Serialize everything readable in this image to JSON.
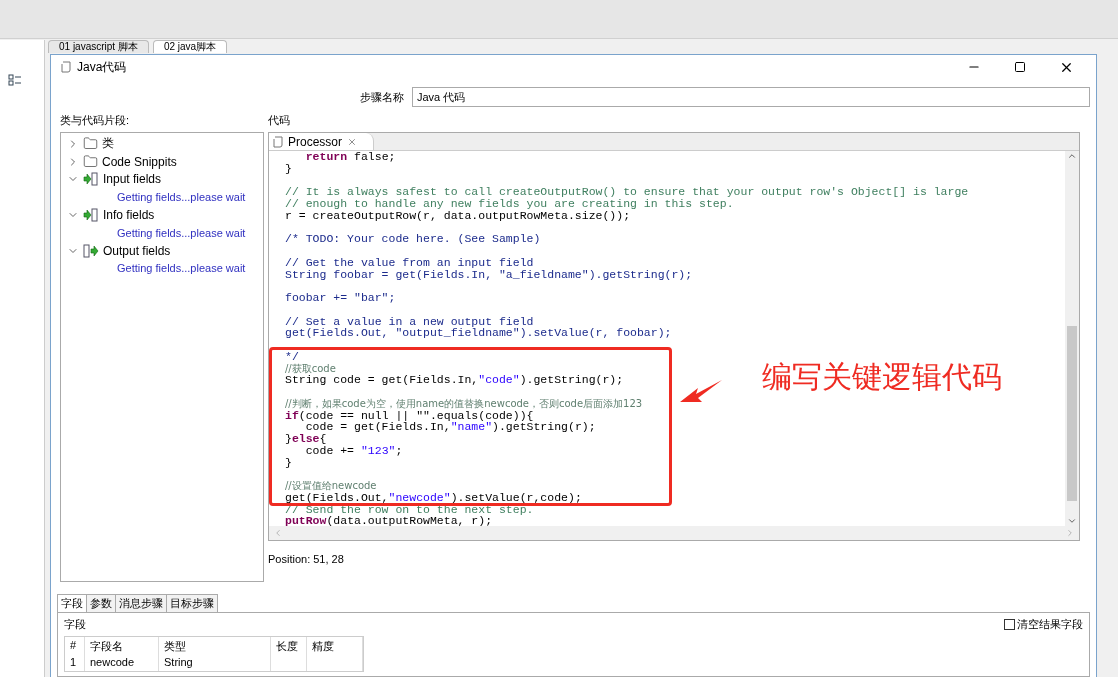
{
  "background": {
    "tabs": [
      {
        "label": "01 javascript 脚本",
        "selected": false
      },
      {
        "label": "02 java脚本",
        "selected": true
      }
    ]
  },
  "dialog": {
    "title": "Java代码",
    "step_name": {
      "label": "步骤名称",
      "value": "Java 代码"
    },
    "tree": {
      "label": "类与代码片段:",
      "items": [
        {
          "label": "类",
          "kind": "folder",
          "expanded": false
        },
        {
          "label": "Code Snippits",
          "kind": "folder",
          "expanded": false
        },
        {
          "label": "Input fields",
          "kind": "input",
          "expanded": true,
          "children": [
            {
              "label": "Getting fields...please wait",
              "kind": "message"
            }
          ]
        },
        {
          "label": "Info fields",
          "kind": "input",
          "expanded": true,
          "children": [
            {
              "label": "Getting fields...please wait",
              "kind": "message"
            }
          ]
        },
        {
          "label": "Output fields",
          "kind": "output",
          "expanded": true,
          "children": [
            {
              "label": "Getting fields...please wait",
              "kind": "message"
            }
          ]
        }
      ]
    },
    "editor": {
      "label": "代码",
      "tab": "Processor",
      "lines": [
        {
          "kind": "code",
          "tokens": [
            {
              "kind": "keyword",
              "text": "   return"
            },
            {
              "kind": "plain",
              "text": " false;"
            }
          ]
        },
        {
          "kind": "code",
          "tokens": [
            {
              "kind": "plain",
              "text": "}"
            }
          ]
        },
        {
          "kind": "blank"
        },
        {
          "kind": "code",
          "tokens": [
            {
              "kind": "comment",
              "text": "// It is always safest to call createOutputRow() to ensure that your output row's Object[] is large"
            }
          ]
        },
        {
          "kind": "code",
          "tokens": [
            {
              "kind": "comment",
              "text": "// enough to handle any new fields you are creating in this step."
            }
          ]
        },
        {
          "kind": "code",
          "tokens": [
            {
              "kind": "plain",
              "text": "r = createOutputRow(r, data.outputRowMeta.size());"
            }
          ]
        },
        {
          "kind": "blank"
        },
        {
          "kind": "code",
          "tokens": [
            {
              "kind": "block",
              "text": "/* TODO: Your code here. (See Sample)"
            }
          ]
        },
        {
          "kind": "blank"
        },
        {
          "kind": "code",
          "tokens": [
            {
              "kind": "block",
              "text": "// Get the value from an input field"
            }
          ]
        },
        {
          "kind": "code",
          "tokens": [
            {
              "kind": "block",
              "text": "String foobar = get(Fields.In, \"a_fieldname\").getString(r);"
            }
          ]
        },
        {
          "kind": "blank"
        },
        {
          "kind": "code",
          "tokens": [
            {
              "kind": "block",
              "text": "foobar += \"bar\";"
            }
          ]
        },
        {
          "kind": "blank"
        },
        {
          "kind": "code",
          "tokens": [
            {
              "kind": "block",
              "text": "// Set a value in a new output field"
            }
          ]
        },
        {
          "kind": "code",
          "tokens": [
            {
              "kind": "block",
              "text": "get(Fields.Out, \"output_fieldname\").setValue(r, foobar);"
            }
          ]
        },
        {
          "kind": "blank"
        },
        {
          "kind": "code",
          "tokens": [
            {
              "kind": "block",
              "text": "*/"
            }
          ]
        },
        {
          "kind": "code",
          "tokens": [
            {
              "kind": "note",
              "text": "//获取code"
            }
          ]
        },
        {
          "kind": "code",
          "tokens": [
            {
              "kind": "plain",
              "text": "String code = get(Fields.In,"
            },
            {
              "kind": "string",
              "text": "\"code\""
            },
            {
              "kind": "plain",
              "text": ").getString(r);"
            }
          ]
        },
        {
          "kind": "blank"
        },
        {
          "kind": "code",
          "tokens": [
            {
              "kind": "note",
              "text": "//判断，如果code为空，使用name的值替换newcode，否则code后面添加123"
            }
          ]
        },
        {
          "kind": "code",
          "tokens": [
            {
              "kind": "keyword",
              "text": "if"
            },
            {
              "kind": "plain",
              "text": "(code == null || \"\".equals(code)){"
            }
          ]
        },
        {
          "kind": "code",
          "tokens": [
            {
              "kind": "plain",
              "text": "   code = get(Fields.In,"
            },
            {
              "kind": "string",
              "text": "\"name\""
            },
            {
              "kind": "plain",
              "text": ").getString(r);"
            }
          ]
        },
        {
          "kind": "code",
          "tokens": [
            {
              "kind": "plain",
              "text": "}"
            },
            {
              "kind": "keyword",
              "text": "else"
            },
            {
              "kind": "plain",
              "text": "{"
            }
          ]
        },
        {
          "kind": "code",
          "tokens": [
            {
              "kind": "plain",
              "text": "   code += "
            },
            {
              "kind": "string",
              "text": "\"123\""
            },
            {
              "kind": "plain",
              "text": ";"
            }
          ]
        },
        {
          "kind": "code",
          "tokens": [
            {
              "kind": "plain",
              "text": "}"
            }
          ]
        },
        {
          "kind": "blank"
        },
        {
          "kind": "code",
          "tokens": [
            {
              "kind": "note",
              "text": "//设置值给newcode"
            }
          ]
        },
        {
          "kind": "code",
          "tokens": [
            {
              "kind": "plain",
              "text": "get(Fields.Out,"
            },
            {
              "kind": "string",
              "text": "\"newcode\""
            },
            {
              "kind": "plain",
              "text": ").setValue(r,code);"
            }
          ]
        },
        {
          "kind": "code",
          "tokens": [
            {
              "kind": "comment",
              "text": "// Send the row on to the next step."
            }
          ]
        },
        {
          "kind": "code",
          "tokens": [
            {
              "kind": "keyword",
              "text": "putRow"
            },
            {
              "kind": "plain",
              "text": "(data.outputRowMeta, r);"
            }
          ]
        }
      ]
    },
    "position": "Position: 51, 28",
    "bottom_tabs": [
      {
        "label": "字段",
        "selected": true
      },
      {
        "label": "参数",
        "selected": false
      },
      {
        "label": "消息步骤",
        "selected": false
      },
      {
        "label": "目标步骤",
        "selected": false
      }
    ],
    "fields": {
      "label": "字段",
      "clear_checkbox": {
        "label": "清空结果字段",
        "checked": false
      },
      "columns": [
        "#",
        "字段名",
        "类型",
        "长度",
        "精度"
      ],
      "rows": [
        {
          "cells": [
            "1",
            "newcode",
            "String"
          ]
        }
      ]
    }
  },
  "annotation": {
    "text": "编写关键逻辑代码"
  }
}
